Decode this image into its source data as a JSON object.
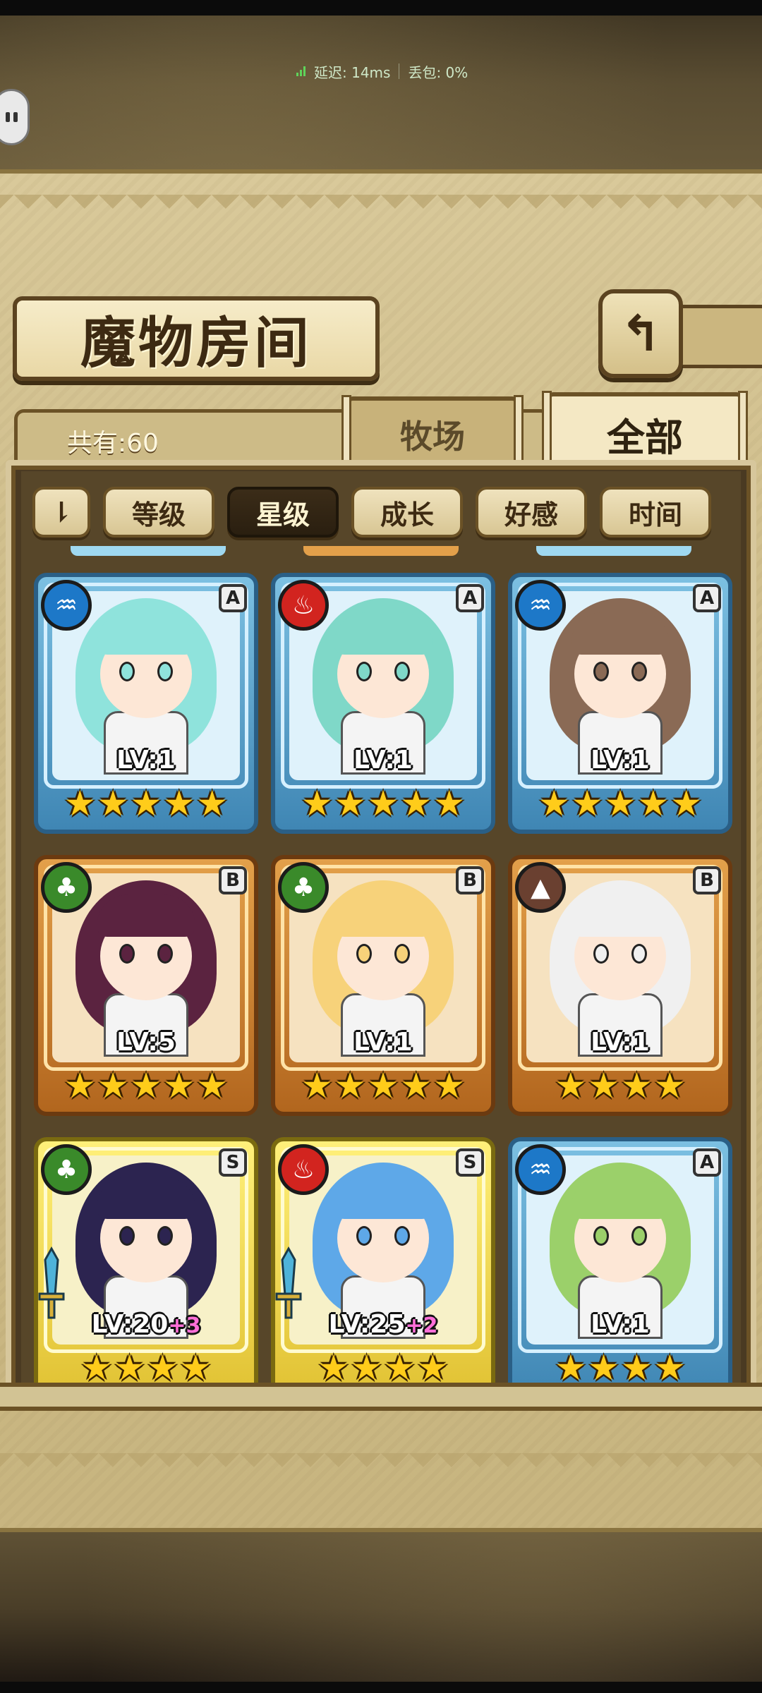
{
  "status": {
    "latency": "延迟: 14ms",
    "packet_loss": "丢包: 0%"
  },
  "header": {
    "title": "魔物房间",
    "back_icon": "back-arrow-icon"
  },
  "summary": {
    "total_label": "共有:60"
  },
  "tabs": [
    {
      "label": "牧场",
      "active": false
    },
    {
      "label": "全部",
      "active": true
    }
  ],
  "sort": {
    "toggle_label": "⇂",
    "buttons": [
      {
        "label": "等级",
        "active": false
      },
      {
        "label": "星级",
        "active": true
      },
      {
        "label": "成长",
        "active": false
      },
      {
        "label": "好感",
        "active": false
      },
      {
        "label": "时间",
        "active": false
      }
    ]
  },
  "monsters": [
    {
      "rank": "A",
      "level": "LV:1",
      "plus": "",
      "stars": 5,
      "element": "water",
      "frame": "blue",
      "hair": "#8fe3dc"
    },
    {
      "rank": "A",
      "level": "LV:1",
      "plus": "",
      "stars": 5,
      "element": "fire",
      "frame": "blue",
      "hair": "#7fd8c8"
    },
    {
      "rank": "A",
      "level": "LV:1",
      "plus": "",
      "stars": 5,
      "element": "water",
      "frame": "blue",
      "hair": "#8a6a55"
    },
    {
      "rank": "B",
      "level": "LV:5",
      "plus": "",
      "stars": 5,
      "element": "wood",
      "frame": "orange",
      "hair": "#5b2340"
    },
    {
      "rank": "B",
      "level": "LV:1",
      "plus": "",
      "stars": 5,
      "element": "wood",
      "frame": "orange",
      "hair": "#f7d27a"
    },
    {
      "rank": "B",
      "level": "LV:1",
      "plus": "",
      "stars": 4,
      "element": "earth",
      "frame": "orange",
      "hair": "#f0f0f0"
    },
    {
      "rank": "S",
      "level": "LV:20",
      "plus": "+3",
      "stars": 4,
      "element": "wood",
      "frame": "gold",
      "hair": "#2c2450"
    },
    {
      "rank": "S",
      "level": "LV:25",
      "plus": "+2",
      "stars": 4,
      "element": "fire",
      "frame": "gold",
      "hair": "#5ea8e8"
    },
    {
      "rank": "A",
      "level": "LV:1",
      "plus": "",
      "stars": 4,
      "element": "water",
      "frame": "blue",
      "hair": "#9bd06a"
    }
  ],
  "element_colors": {
    "water": "#1d78c8",
    "fire": "#d2241f",
    "wood": "#3a8a2a",
    "earth": "#6a4030"
  }
}
